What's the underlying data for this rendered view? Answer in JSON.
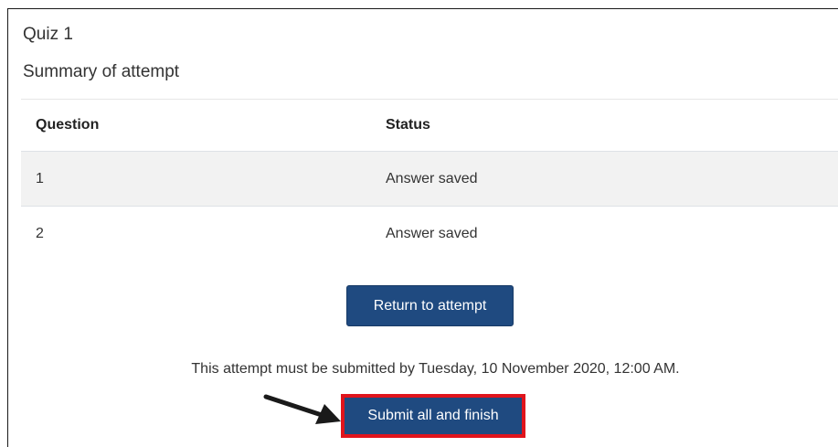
{
  "quiz": {
    "title": "Quiz 1",
    "summary_heading": "Summary of attempt"
  },
  "table": {
    "headers": [
      "Question",
      "Status"
    ],
    "rows": [
      {
        "question": "1",
        "status": "Answer saved"
      },
      {
        "question": "2",
        "status": "Answer saved"
      }
    ]
  },
  "actions": {
    "return_label": "Return to attempt",
    "deadline_text": "This attempt must be submitted by Tuesday, 10 November 2020, 12:00 AM.",
    "submit_label": "Submit all and finish"
  },
  "colors": {
    "button_bg": "#1f4a80",
    "highlight_border": "#e0141c",
    "stripe_bg": "#f2f2f2"
  },
  "icons": {
    "pointer": "arrow-pointer-icon"
  }
}
